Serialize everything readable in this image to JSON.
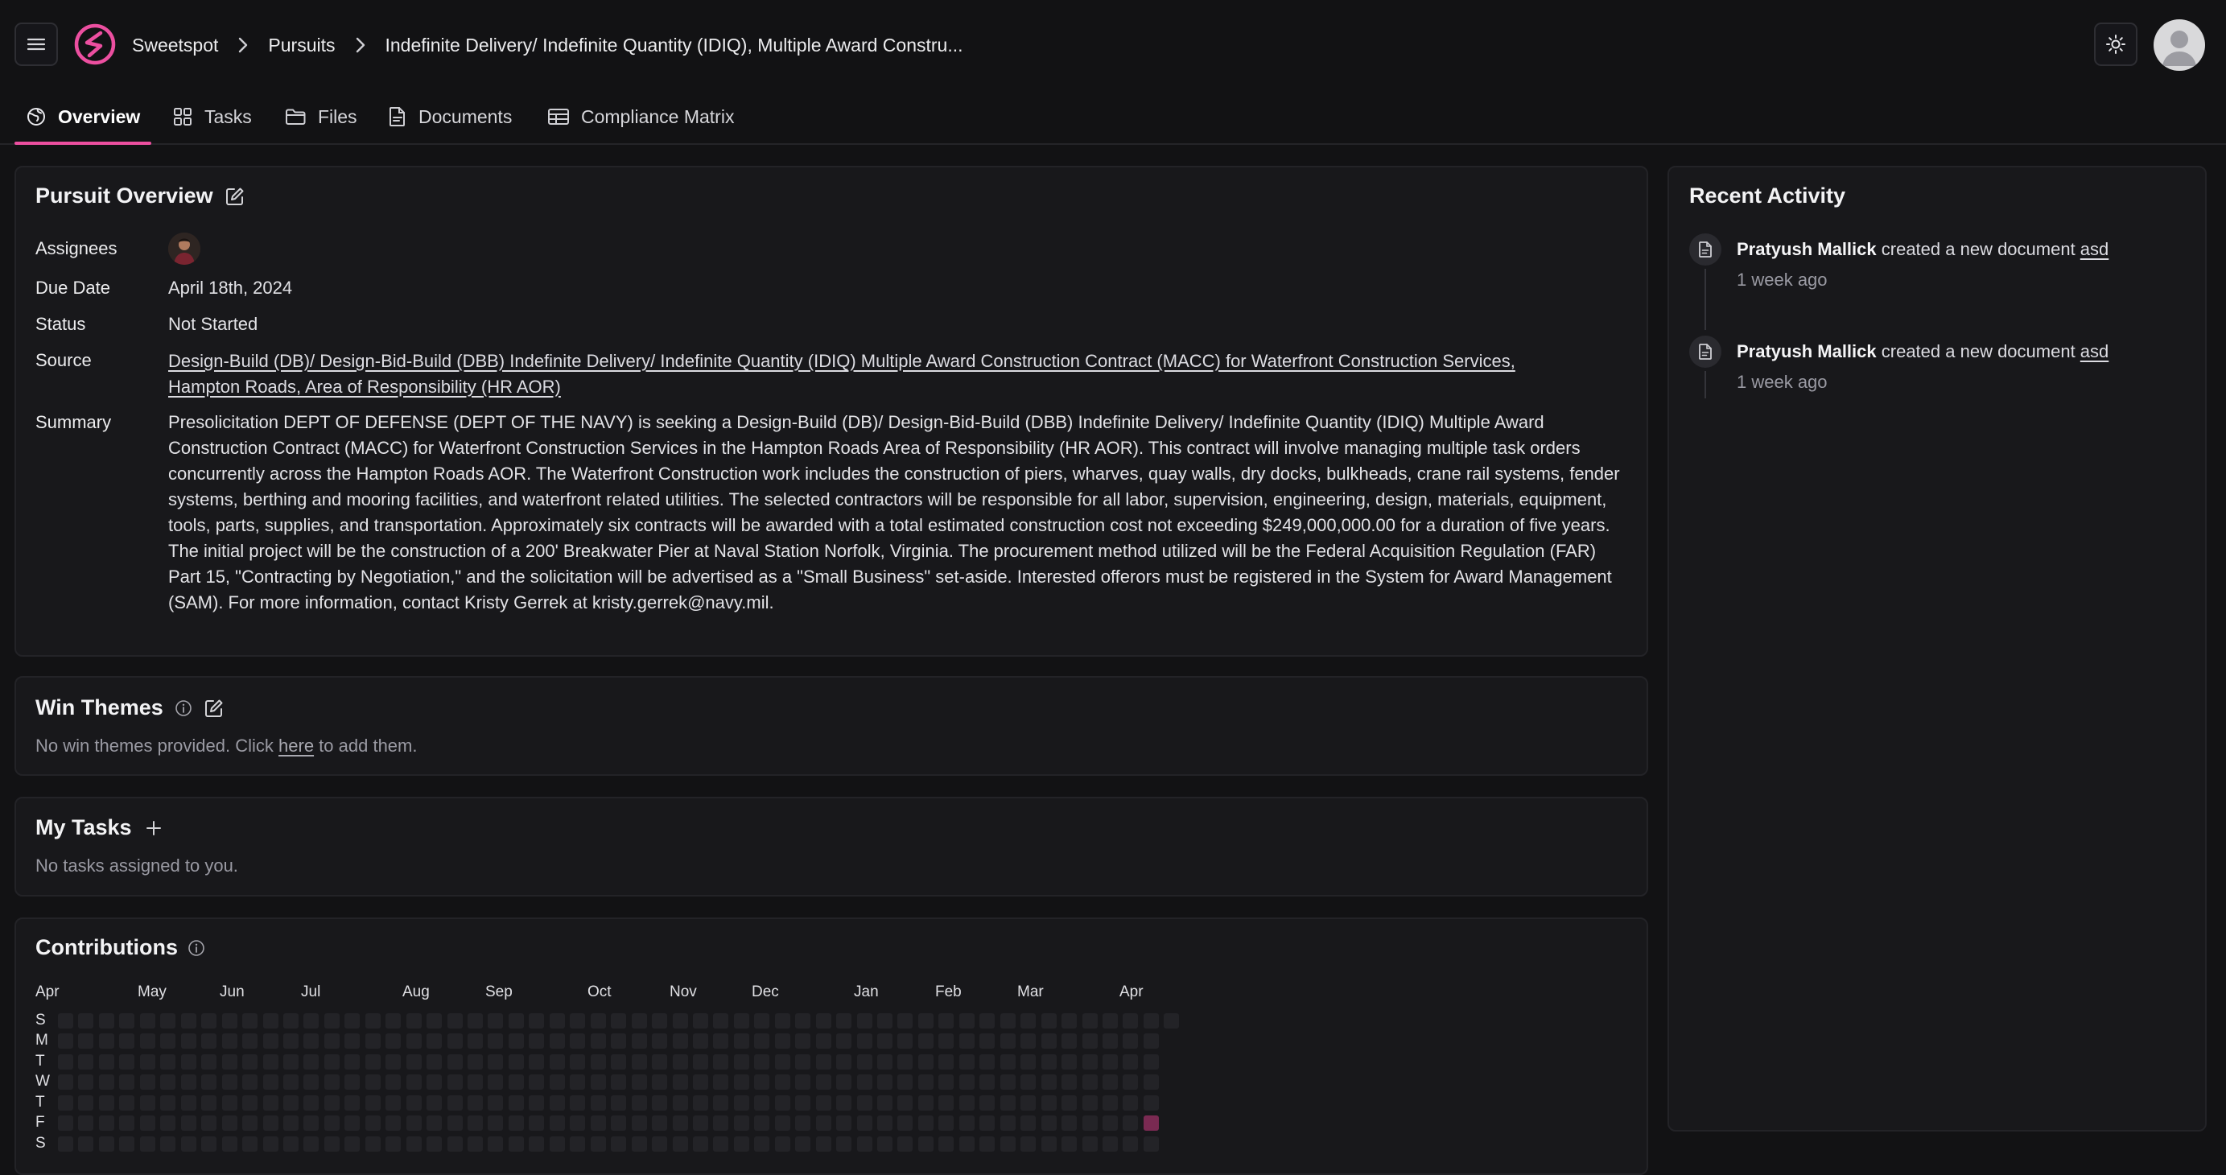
{
  "colors": {
    "accent": "#ec4fa0",
    "background": "#121214",
    "card": "#18181b",
    "contribution_hot": "#7a2a52"
  },
  "header": {
    "breadcrumbs": [
      "Sweetspot",
      "Pursuits",
      "Indefinite Delivery/ Indefinite Quantity (IDIQ), Multiple Award Constru..."
    ],
    "icons": {
      "menu": "hamburger-icon",
      "logo": "sweetspot-logo",
      "theme": "sun-icon",
      "avatar": "user-avatar"
    }
  },
  "tabs": [
    {
      "label": "Overview",
      "icon": "globe-icon",
      "active": true
    },
    {
      "label": "Tasks",
      "icon": "grid-icon",
      "active": false
    },
    {
      "label": "Files",
      "icon": "folder-icon",
      "active": false
    },
    {
      "label": "Documents",
      "icon": "document-icon",
      "active": false
    },
    {
      "label": "Compliance Matrix",
      "icon": "table-icon",
      "active": false
    }
  ],
  "overview": {
    "title": "Pursuit Overview",
    "labels": {
      "assignees": "Assignees",
      "due_date": "Due Date",
      "status": "Status",
      "source": "Source",
      "summary": "Summary"
    },
    "due_date": "April 18th, 2024",
    "status": "Not Started",
    "source_line1": "Design-Build (DB)/ Design-Bid-Build (DBB) Indefinite Delivery/ Indefinite Quantity (IDIQ) Multiple Award Construction Contract (MACC) for Waterfront Construction Services,",
    "source_line2": "Hampton Roads, Area of Responsibility (HR AOR)",
    "summary": "Presolicitation DEPT OF DEFENSE (DEPT OF THE NAVY) is seeking a Design-Build (DB)/ Design-Bid-Build (DBB) Indefinite Delivery/ Indefinite Quantity (IDIQ) Multiple Award Construction Contract (MACC) for Waterfront Construction Services in the Hampton Roads Area of Responsibility (HR AOR). This contract will involve managing multiple task orders concurrently across the Hampton Roads AOR. The Waterfront Construction work includes the construction of piers, wharves, quay walls, dry docks, bulkheads, crane rail systems, fender systems, berthing and mooring facilities, and waterfront related utilities. The selected contractors will be responsible for all labor, supervision, engineering, design, materials, equipment, tools, parts, supplies, and transportation. Approximately six contracts will be awarded with a total estimated construction cost not exceeding $249,000,000.00 for a duration of five years. The initial project will be the construction of a 200' Breakwater Pier at Naval Station Norfolk, Virginia. The procurement method utilized will be the Federal Acquisition Regulation (FAR) Part 15, \"Contracting by Negotiation,\" and the solicitation will be advertised as a \"Small Business\" set-aside. Interested offerors must be registered in the System for Award Management (SAM). For more information, contact Kristy Gerrek at kristy.gerrek@navy.mil."
  },
  "win_themes": {
    "title": "Win Themes",
    "empty_before": "No win themes provided. Click ",
    "empty_link": "here",
    "empty_after": " to add them."
  },
  "my_tasks": {
    "title": "My Tasks",
    "empty": "No tasks assigned to you."
  },
  "contributions": {
    "title": "Contributions",
    "months": [
      "Apr",
      "May",
      "Jun",
      "Jul",
      "Aug",
      "Sep",
      "Oct",
      "Nov",
      "Dec",
      "Jan",
      "Feb",
      "Mar",
      "Apr"
    ],
    "days": [
      "S",
      "M",
      "T",
      "W",
      "T",
      "F",
      "S"
    ],
    "weeks": 55,
    "active": [
      {
        "week": 53,
        "day": 5,
        "level": 1
      }
    ]
  },
  "activity": {
    "title": "Recent Activity",
    "items": [
      {
        "user": "Pratyush Mallick",
        "action": " created a new document ",
        "target": "asd",
        "time": "1 week ago"
      },
      {
        "user": "Pratyush Mallick",
        "action": " created a new document ",
        "target": "asd",
        "time": "1 week ago"
      }
    ]
  }
}
